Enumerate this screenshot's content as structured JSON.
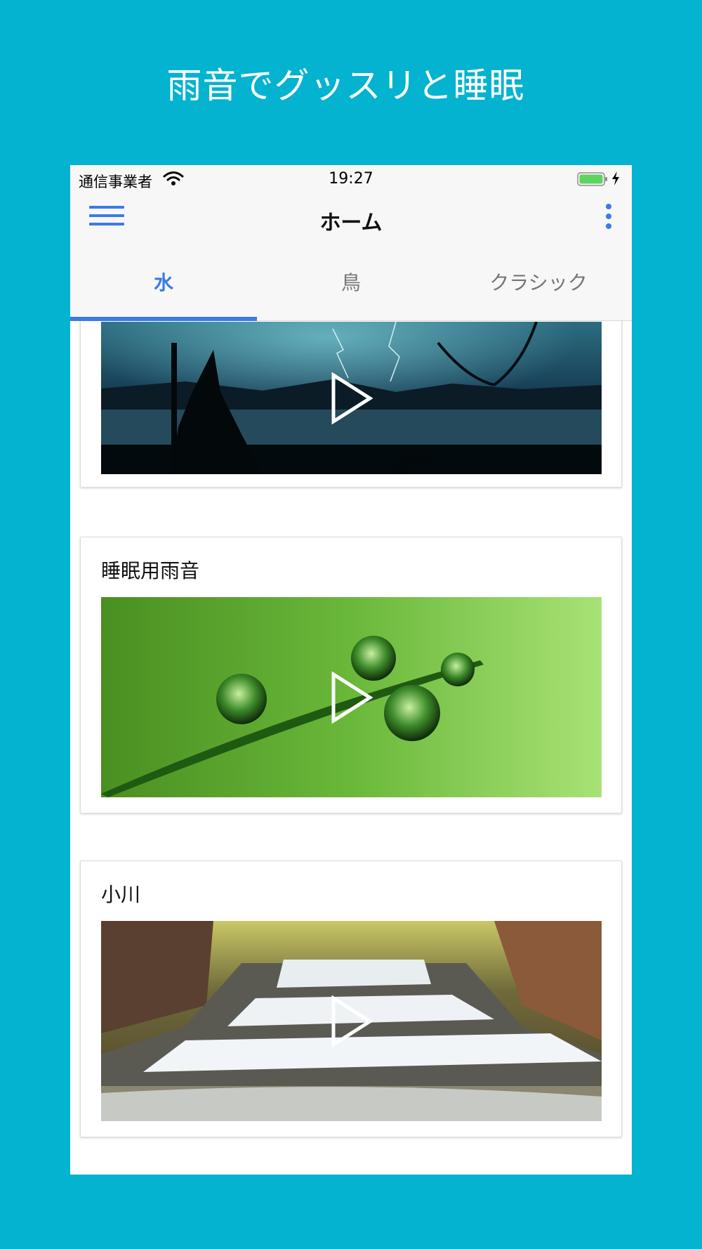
{
  "promo": {
    "headline": "雨音でグッスリと睡眠"
  },
  "status_bar": {
    "carrier": "通信事業者",
    "time": "19:27"
  },
  "app_bar": {
    "title": "ホーム",
    "menu_icon": "hamburger-menu-icon",
    "more_icon": "more-vert-icon"
  },
  "tabs": [
    {
      "label": "水",
      "active": true
    },
    {
      "label": "鳥",
      "active": false
    },
    {
      "label": "クラシック",
      "active": false
    }
  ],
  "colors": {
    "background": "#03b3cf",
    "accent": "#3b7be6",
    "bar": "#f7f7f7"
  },
  "cards": [
    {
      "title": "",
      "image": "night-lake-lightning-witch"
    },
    {
      "title": "睡眠用雨音",
      "image": "water-drops-on-grass"
    },
    {
      "title": "小川",
      "image": "forest-stream-waterfall"
    }
  ]
}
